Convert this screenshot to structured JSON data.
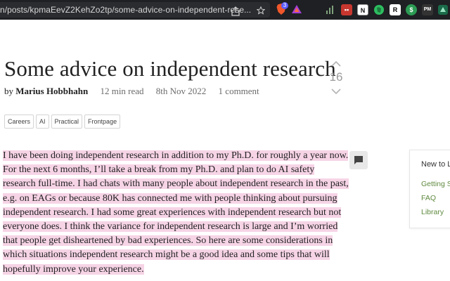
{
  "browser": {
    "url": "n/posts/kpmaEevZ2KehZo2tp/some-advice-on-independent-rese...",
    "brave_badge": "3",
    "extensions": [
      {
        "name": "bar-chart-icon",
        "color": "#1f2023",
        "label": ""
      },
      {
        "name": "red-extension-icon",
        "color": "#c7372f",
        "label": "▪▪"
      },
      {
        "name": "notion-icon",
        "color": "#ffffff",
        "label": "N"
      },
      {
        "name": "evernote-icon",
        "color": "#2dbe60",
        "label": ""
      },
      {
        "name": "readwise-icon",
        "color": "#ffffff",
        "label": "R"
      },
      {
        "name": "dollar-icon",
        "color": "#2c9b54",
        "label": "$"
      },
      {
        "name": "pocket-icon",
        "color": "#333333",
        "label": "PM"
      },
      {
        "name": "green-extension-icon",
        "color": "#1a6b4a",
        "label": ""
      }
    ]
  },
  "post": {
    "title": "Some advice on independent research",
    "by": "by",
    "author": "Marius Hobbhahn",
    "read_time": "12 min read",
    "date": "8th Nov 2022",
    "comments": "1 comment",
    "score": "16",
    "tags": [
      "Careers",
      "AI",
      "Practical",
      "Frontpage"
    ],
    "body": "I have been doing independent research in addition to my Ph.D. for roughly a year now. For the next 6 months, I’ll take a break from my Ph.D. and plan to do AI safety research full-time. I had chats with many people about independent research in the past, e.g. on EAGs or because 80K has connected me with people thinking about pursuing independent research. I had some great experiences with independent research but not everyone does. I think the variance for independent research is large and I’m worried that people get disheartened by bad experiences. So here are some considerations in which situations independent research might be a good idea and some tips that will hopefully improve your experience."
  },
  "sidebar": {
    "title": "New to L",
    "links": [
      "Getting S",
      "FAQ",
      "Library"
    ]
  }
}
